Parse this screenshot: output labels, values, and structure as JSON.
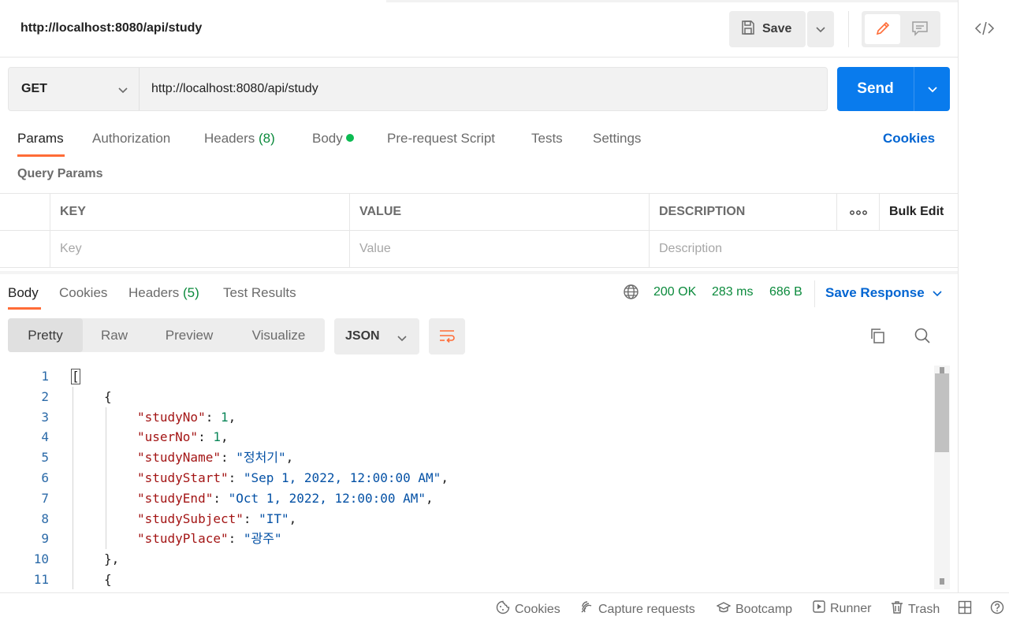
{
  "request": {
    "title": "http://localhost:8080/api/study",
    "save_label": "Save",
    "method": "GET",
    "url": "http://localhost:8080/api/study",
    "send_label": "Send"
  },
  "req_tabs": {
    "params": "Params",
    "authorization": "Authorization",
    "headers": "Headers",
    "headers_count": "(8)",
    "body": "Body",
    "pre_request": "Pre-request Script",
    "tests": "Tests",
    "settings": "Settings",
    "cookies": "Cookies"
  },
  "query_params": {
    "title": "Query Params",
    "columns": {
      "key": "KEY",
      "value": "VALUE",
      "description": "DESCRIPTION",
      "bulk_edit": "Bulk Edit"
    },
    "placeholders": {
      "key": "Key",
      "value": "Value",
      "description": "Description"
    }
  },
  "response": {
    "tabs": {
      "body": "Body",
      "cookies": "Cookies",
      "headers": "Headers",
      "headers_count": "(5)",
      "test_results": "Test Results"
    },
    "status": "200 OK",
    "time": "283 ms",
    "size": "686 B",
    "save_response": "Save Response",
    "views": {
      "pretty": "Pretty",
      "raw": "Raw",
      "preview": "Preview",
      "visualize": "Visualize"
    },
    "format": "JSON"
  },
  "code_lines": [
    {
      "n": "1",
      "indent": 0,
      "text": "["
    },
    {
      "n": "2",
      "indent": 1,
      "text": "{"
    },
    {
      "n": "3",
      "indent": 2,
      "key": "\"studyNo\"",
      "sep": ": ",
      "val": "1",
      "type": "num",
      "tail": ","
    },
    {
      "n": "4",
      "indent": 2,
      "key": "\"userNo\"",
      "sep": ": ",
      "val": "1",
      "type": "num",
      "tail": ","
    },
    {
      "n": "5",
      "indent": 2,
      "key": "\"studyName\"",
      "sep": ": ",
      "val": "\"정처기\"",
      "type": "str",
      "tail": ","
    },
    {
      "n": "6",
      "indent": 2,
      "key": "\"studyStart\"",
      "sep": ": ",
      "val": "\"Sep 1, 2022, 12:00:00 AM\"",
      "type": "str",
      "tail": ","
    },
    {
      "n": "7",
      "indent": 2,
      "key": "\"studyEnd\"",
      "sep": ": ",
      "val": "\"Oct 1, 2022, 12:00:00 AM\"",
      "type": "str",
      "tail": ","
    },
    {
      "n": "8",
      "indent": 2,
      "key": "\"studySubject\"",
      "sep": ": ",
      "val": "\"IT\"",
      "type": "str",
      "tail": ","
    },
    {
      "n": "9",
      "indent": 2,
      "key": "\"studyPlace\"",
      "sep": ": ",
      "val": "\"광주\"",
      "type": "str",
      "tail": ""
    },
    {
      "n": "10",
      "indent": 1,
      "text": "},"
    },
    {
      "n": "11",
      "indent": 1,
      "text": "{"
    }
  ],
  "footer": {
    "cookies": "Cookies",
    "capture": "Capture requests",
    "bootcamp": "Bootcamp",
    "runner": "Runner",
    "trash": "Trash"
  },
  "colors": {
    "accent": "#ff6c37",
    "send": "#097bed",
    "link": "#0265d2",
    "success": "#0b8a3c"
  }
}
